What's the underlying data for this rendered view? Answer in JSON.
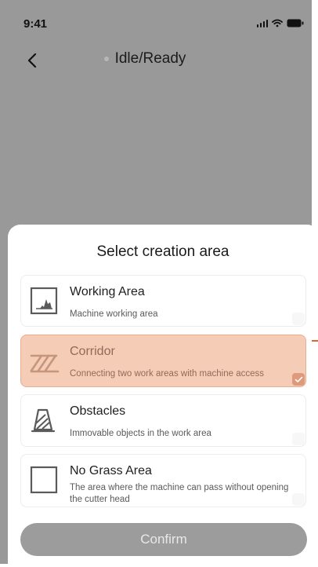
{
  "status_bar": {
    "time": "9:41"
  },
  "nav": {
    "title": "Idle/Ready"
  },
  "sheet": {
    "title": "Select creation area",
    "options": [
      {
        "title": "Working Area",
        "description": "Machine working area",
        "icon": "working-area-icon",
        "selected": false
      },
      {
        "title": "Corridor",
        "description": "Connecting two work areas with machine access",
        "icon": "corridor-icon",
        "selected": true
      },
      {
        "title": "Obstacles",
        "description": "Immovable objects in the work area",
        "icon": "obstacle-icon",
        "selected": false
      },
      {
        "title": "No Grass Area",
        "description": "The area where the machine can pass without opening the cutter head",
        "icon": "no-grass-area-icon",
        "selected": false
      }
    ],
    "confirm_label": "Confirm"
  },
  "colors": {
    "overlay": "#999999",
    "selected_bg": "#f5cdb7",
    "selected_border": "#e6ad91",
    "accent": "#de9a7a",
    "confirm_bg": "#9c9c9c"
  }
}
